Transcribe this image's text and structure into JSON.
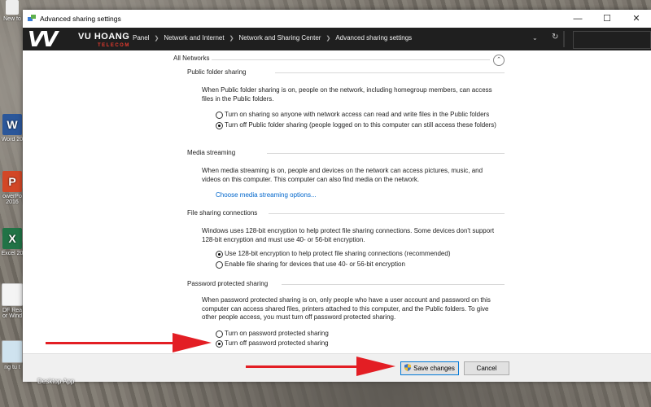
{
  "window": {
    "title": "Advanced sharing settings"
  },
  "watermark": {
    "brand": "VU HOANG",
    "sub": "TELECOM"
  },
  "desktop_icons": [
    {
      "label": "New fo",
      "letter": ""
    },
    {
      "label": "Word 20",
      "letter": "W"
    },
    {
      "label": "owerPo 2016",
      "letter": "P"
    },
    {
      "label": "Excel 20",
      "letter": "X"
    },
    {
      "label": "DF Rea or Wind",
      "letter": ""
    },
    {
      "label": "ng tu t",
      "letter": ""
    }
  ],
  "desktop_app_label": "Desktop App",
  "breadcrumb": [
    "Panel",
    "Network and Internet",
    "Network and Sharing Center",
    "Advanced sharing settings"
  ],
  "content": {
    "all_networks": "All Networks",
    "public_folder": {
      "title": "Public folder sharing",
      "desc": "When Public folder sharing is on, people on the network, including homegroup members, can access files in the Public folders.",
      "opt_on": "Turn on sharing so anyone with network access can read and write files in the Public folders",
      "opt_off": "Turn off Public folder sharing (people logged on to this computer can still access these folders)"
    },
    "media": {
      "title": "Media streaming",
      "desc": "When media streaming is on, people and devices on the network can access pictures, music, and videos on this computer. This computer can also find media on the network.",
      "link": "Choose media streaming options..."
    },
    "file_sharing": {
      "title": "File sharing connections",
      "desc": "Windows uses 128-bit encryption to help protect file sharing connections. Some devices don't support 128-bit encryption and must use 40- or 56-bit encryption.",
      "opt_128": "Use 128-bit encryption to help protect file sharing connections (recommended)",
      "opt_40": "Enable file sharing for devices that use 40- or 56-bit encryption"
    },
    "password": {
      "title": "Password protected sharing",
      "desc": "When password protected sharing is on, only people who have a user account and password on this computer can access shared files, printers attached to this computer, and the Public folders. To give other people access, you must turn off password protected sharing.",
      "opt_on": "Turn on password protected sharing",
      "opt_off": "Turn off password protected sharing"
    }
  },
  "footer": {
    "save": "Save changes",
    "cancel": "Cancel"
  },
  "colors": {
    "accent": "#0078d7",
    "link": "#0066cc",
    "annotation": "#e31e24"
  }
}
